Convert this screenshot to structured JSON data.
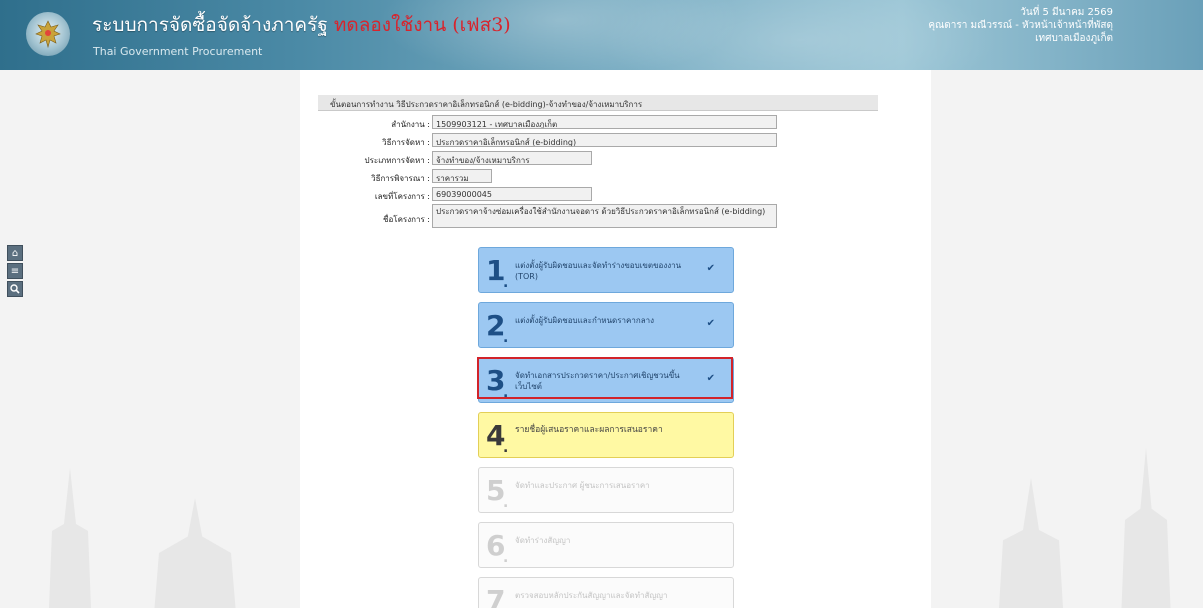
{
  "header": {
    "system_title": "ระบบการจัดซื้อจัดจ้างภาครัฐ",
    "test_label": "ทดลองใช้งาน (เฟส3)",
    "subtitle": "Thai Government Procurement",
    "date": "วันที่ 5 มีนาคม 2569",
    "user": "คุณดารา มณีวรรณ์ - หัวหน้าเจ้าหน้าที่พัสดุ",
    "org": "เทศบาลเมืองภูเก็ต"
  },
  "tools": [
    "home-icon",
    "menu-icon",
    "search-icon"
  ],
  "info": {
    "heading": "ขั้นตอนการทำงาน วิธีประกวดราคาอิเล็กทรอนิกส์ (e-bidding)-จ้างทำของ/จ้างเหมาบริการ",
    "rows": [
      {
        "label": "สำนักงาน :",
        "value": "1509903121 - เทศบาลเมืองภูเก็ต"
      },
      {
        "label": "วิธีการจัดหา :",
        "value": "ประกวดราคาอิเล็กทรอนิกส์ (e-bidding)"
      },
      {
        "label": "ประเภทการจัดหา :",
        "value": "จ้างทำของ/จ้างเหมาบริการ"
      },
      {
        "label": "วิธีการพิจารณา :",
        "value": "ราคารวม"
      },
      {
        "label": "เลขที่โครงการ :",
        "value": "69039000045"
      },
      {
        "label": "ชื่อโครงการ :",
        "value": "ประกวดราคาจ้างซ่อมเครื่องใช้สำนักงานจอดาร ด้วยวิธีประกวดราคาอิเล็กทรอนิกส์ (e-bidding)"
      }
    ]
  },
  "steps": [
    {
      "num": "1",
      "text": "แต่งตั้งผู้รับผิดชอบและจัดทำร่างขอบเขตของงาน (TOR)",
      "status": "done"
    },
    {
      "num": "2",
      "text": "แต่งตั้งผู้รับผิดชอบและกำหนดราคากลาง",
      "status": "done"
    },
    {
      "num": "3",
      "text": "จัดทำเอกสารประกวดราคา/ประกาศเชิญชวนขึ้นเว็บไซต์",
      "status": "done"
    },
    {
      "num": "4",
      "text": "รายชื่อผู้เสนอราคาและผลการเสนอราคา",
      "status": "current"
    },
    {
      "num": "5",
      "text": "จัดทำและประกาศ ผู้ชนะการเสนอราคา",
      "status": "disabled"
    },
    {
      "num": "6",
      "text": "จัดทำร่างสัญญา",
      "status": "disabled"
    },
    {
      "num": "7",
      "text": "ตรวจสอบหลักประกันสัญญาและจัดทำสัญญา",
      "status": "disabled"
    }
  ],
  "check_mark": "✔",
  "colors": {
    "done": "#9cc8f2",
    "current": "#fff9a3",
    "highlight": "#d2232a"
  }
}
